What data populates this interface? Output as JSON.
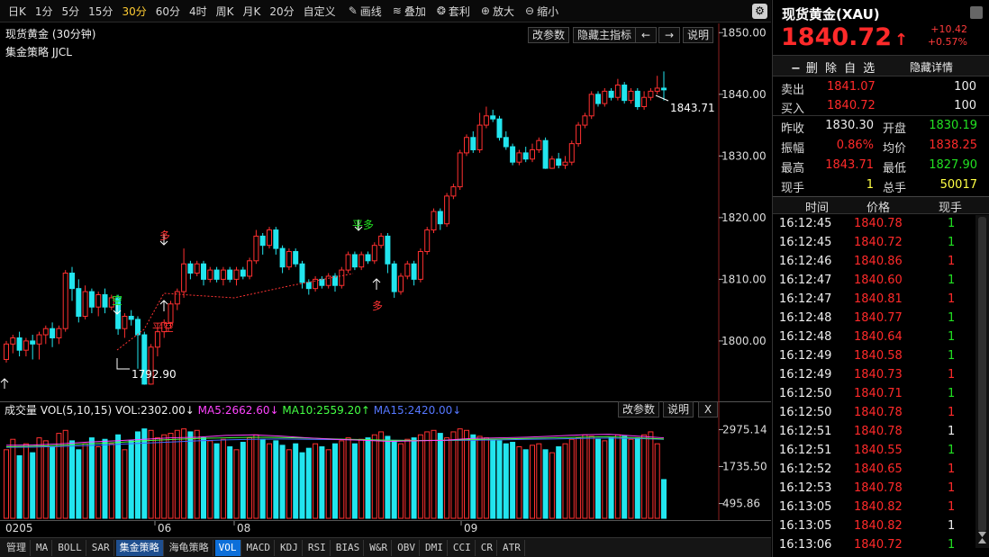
{
  "toolbar": {
    "periods": [
      "日K",
      "1分",
      "5分",
      "15分",
      "30分",
      "60分",
      "4时",
      "周K",
      "月K",
      "20分",
      "自定义"
    ],
    "active_period": "30分",
    "tools": [
      {
        "icon": "pencil-icon",
        "label": "画线"
      },
      {
        "icon": "stack-icon",
        "label": "叠加"
      },
      {
        "icon": "money-bag-icon",
        "label": "套利"
      },
      {
        "icon": "zoom-in-icon",
        "label": "放大"
      },
      {
        "icon": "zoom-out-icon",
        "label": "缩小"
      }
    ],
    "settings_icon": "gear-icon"
  },
  "chart": {
    "title": "现货黄金 (30分钟)",
    "indicator": "集金策略 JJCL",
    "buttons": {
      "edit_params": "改参数",
      "hide_indicator": "隐藏主指标",
      "prev": "←",
      "next": "→",
      "help": "说明"
    },
    "last_price_label": "1843.71",
    "low_label": "1792.90",
    "signals": [
      {
        "text": "空",
        "color": "#22e022"
      },
      {
        "text": "平空",
        "color": "#ff3333"
      },
      {
        "text": "多",
        "color": "#ff3333"
      },
      {
        "text": "平多",
        "color": "#22e022"
      },
      {
        "text": "多",
        "color": "#ff3333"
      }
    ]
  },
  "volume": {
    "title": "成交量",
    "params": "VOL(5,10,15)",
    "vol": "VOL:2302.00↓",
    "ma5": "MA5:2662.60↓",
    "ma10": "MA10:2559.20↑",
    "ma15": "MA15:2420.00↓",
    "colors": {
      "ma5": "#ff44ff",
      "ma10": "#44ff44",
      "ma15": "#4466ff"
    },
    "buttons": {
      "edit_params": "改参数",
      "help": "说明",
      "close": "X"
    },
    "yticks": [
      "2975.14",
      "1735.50",
      "495.86"
    ]
  },
  "dates": [
    "0205",
    "06",
    "08",
    "09"
  ],
  "tabs": [
    "管理",
    "MA",
    "BOLL",
    "SAR",
    "集金策略",
    "海龟策略",
    "VOL",
    "MACD",
    "KDJ",
    "RSI",
    "BIAS",
    "W&R",
    "OBV",
    "DMI",
    "CCI",
    "CR",
    "ATR"
  ],
  "quote": {
    "name": "现货黄金(XAU)",
    "price": "1840.72",
    "arrow": "↑",
    "change": "+10.42",
    "change_pct": "+0.57%",
    "remove_fav": "删 除 自 选",
    "hide_detail": "隐藏详情",
    "ask": {
      "label": "卖出",
      "price": "1841.07",
      "size": "100"
    },
    "bid": {
      "label": "买入",
      "price": "1840.72",
      "size": "100"
    },
    "stats": [
      {
        "l1": "昨收",
        "v1": "1830.30",
        "c1": "white",
        "l2": "开盘",
        "v2": "1830.19",
        "c2": "green"
      },
      {
        "l1": "振幅",
        "v1": "0.86%",
        "c1": "red",
        "l2": "均价",
        "v2": "1838.25",
        "c2": "red"
      },
      {
        "l1": "最高",
        "v1": "1843.71",
        "c1": "red",
        "l2": "最低",
        "v2": "1827.90",
        "c2": "green"
      },
      {
        "l1": "现手",
        "v1": "1",
        "c1": "yellow",
        "l2": "总手",
        "v2": "50017",
        "c2": "yellow"
      }
    ],
    "tick_headers": {
      "time": "时间",
      "price": "价格",
      "vol": "现手"
    },
    "ticks": [
      {
        "t": "16:12:45",
        "p": "1840.78",
        "v": "1",
        "c": "green"
      },
      {
        "t": "16:12:45",
        "p": "1840.72",
        "v": "1",
        "c": "green"
      },
      {
        "t": "16:12:46",
        "p": "1840.86",
        "v": "1",
        "c": "red"
      },
      {
        "t": "16:12:47",
        "p": "1840.60",
        "v": "1",
        "c": "green"
      },
      {
        "t": "16:12:47",
        "p": "1840.81",
        "v": "1",
        "c": "red"
      },
      {
        "t": "16:12:48",
        "p": "1840.77",
        "v": "1",
        "c": "green"
      },
      {
        "t": "16:12:48",
        "p": "1840.64",
        "v": "1",
        "c": "green"
      },
      {
        "t": "16:12:49",
        "p": "1840.58",
        "v": "1",
        "c": "green"
      },
      {
        "t": "16:12:49",
        "p": "1840.73",
        "v": "1",
        "c": "red"
      },
      {
        "t": "16:12:50",
        "p": "1840.71",
        "v": "1",
        "c": "green"
      },
      {
        "t": "16:12:50",
        "p": "1840.78",
        "v": "1",
        "c": "red"
      },
      {
        "t": "16:12:51",
        "p": "1840.78",
        "v": "1",
        "c": "white"
      },
      {
        "t": "16:12:51",
        "p": "1840.55",
        "v": "1",
        "c": "green"
      },
      {
        "t": "16:12:52",
        "p": "1840.65",
        "v": "1",
        "c": "red"
      },
      {
        "t": "16:12:53",
        "p": "1840.78",
        "v": "1",
        "c": "red"
      },
      {
        "t": "16:13:05",
        "p": "1840.82",
        "v": "1",
        "c": "red"
      },
      {
        "t": "16:13:05",
        "p": "1840.82",
        "v": "1",
        "c": "white"
      },
      {
        "t": "16:13:06",
        "p": "1840.72",
        "v": "1",
        "c": "green"
      }
    ]
  },
  "chart_data": {
    "type": "candlestick",
    "price_yaxis": [
      "1850.00",
      "1840.00",
      "1830.00",
      "1820.00",
      "1810.00",
      "1800.00"
    ],
    "price_ylim": [
      1790.5,
      1851.5
    ],
    "candles": [
      [
        1797.0,
        1799.5,
        1796.5,
        1800.0,
        1
      ],
      [
        1799.5,
        1800.5,
        1798.0,
        1801.0,
        1
      ],
      [
        1800.5,
        1798.5,
        1797.5,
        1801.5,
        0
      ],
      [
        1798.5,
        1800.0,
        1797.5,
        1800.5,
        1
      ],
      [
        1800.0,
        1799.5,
        1797.0,
        1801.0,
        0
      ],
      [
        1799.5,
        1801.0,
        1797.0,
        1801.5,
        1
      ],
      [
        1801.0,
        1802.0,
        1799.5,
        1802.5,
        1
      ],
      [
        1802.0,
        1800.5,
        1799.0,
        1803.0,
        0
      ],
      [
        1800.5,
        1802.0,
        1799.5,
        1802.5,
        1
      ],
      [
        1802.0,
        1811.0,
        1801.5,
        1811.5,
        1
      ],
      [
        1811.0,
        1808.5,
        1806.5,
        1812.0,
        0
      ],
      [
        1808.5,
        1804.0,
        1803.0,
        1810.0,
        0
      ],
      [
        1804.0,
        1808.0,
        1803.5,
        1809.0,
        1
      ],
      [
        1808.0,
        1805.5,
        1804.5,
        1808.5,
        0
      ],
      [
        1805.5,
        1807.5,
        1804.0,
        1808.0,
        1
      ],
      [
        1807.5,
        1805.5,
        1804.5,
        1808.5,
        0
      ],
      [
        1805.5,
        1807.0,
        1805.0,
        1807.5,
        1
      ],
      [
        1807.0,
        1802.0,
        1801.0,
        1807.5,
        0
      ],
      [
        1802.0,
        1804.0,
        1800.5,
        1804.5,
        1
      ],
      [
        1804.0,
        1803.5,
        1802.5,
        1805.0,
        0
      ],
      [
        1803.5,
        1801.0,
        1795.5,
        1804.0,
        0
      ],
      [
        1801.0,
        1793.0,
        1792.9,
        1801.5,
        0
      ],
      [
        1793.0,
        1799.0,
        1792.9,
        1799.5,
        1
      ],
      [
        1799.0,
        1801.5,
        1797.5,
        1802.0,
        1
      ],
      [
        1801.5,
        1803.0,
        1800.5,
        1803.5,
        1
      ],
      [
        1803.0,
        1806.0,
        1802.0,
        1806.5,
        1
      ],
      [
        1806.0,
        1808.0,
        1805.0,
        1808.5,
        1
      ],
      [
        1808.0,
        1812.5,
        1807.0,
        1815.0,
        1
      ],
      [
        1812.5,
        1811.0,
        1810.0,
        1813.0,
        0
      ],
      [
        1811.0,
        1812.5,
        1810.5,
        1813.0,
        1
      ],
      [
        1812.5,
        1810.0,
        1809.0,
        1813.0,
        0
      ],
      [
        1810.0,
        1811.5,
        1809.5,
        1812.0,
        1
      ],
      [
        1811.5,
        1810.0,
        1809.5,
        1812.0,
        0
      ],
      [
        1810.0,
        1811.5,
        1809.0,
        1812.0,
        1
      ],
      [
        1811.5,
        1810.0,
        1809.5,
        1812.0,
        0
      ],
      [
        1810.0,
        1811.5,
        1809.0,
        1812.0,
        1
      ],
      [
        1811.5,
        1810.5,
        1810.0,
        1812.0,
        0
      ],
      [
        1810.5,
        1813.0,
        1810.0,
        1813.5,
        1
      ],
      [
        1813.0,
        1817.0,
        1812.5,
        1818.0,
        1
      ],
      [
        1817.0,
        1815.5,
        1814.0,
        1817.5,
        0
      ],
      [
        1815.5,
        1818.0,
        1815.0,
        1818.5,
        1
      ],
      [
        1818.0,
        1815.0,
        1814.0,
        1818.5,
        0
      ],
      [
        1815.0,
        1812.0,
        1811.0,
        1815.5,
        0
      ],
      [
        1812.0,
        1814.5,
        1811.5,
        1815.0,
        1
      ],
      [
        1814.5,
        1812.5,
        1812.0,
        1815.0,
        0
      ],
      [
        1812.5,
        1809.5,
        1808.5,
        1813.0,
        0
      ],
      [
        1809.5,
        1808.5,
        1807.5,
        1810.0,
        0
      ],
      [
        1808.5,
        1810.0,
        1808.0,
        1810.5,
        1
      ],
      [
        1810.0,
        1809.0,
        1808.5,
        1810.5,
        0
      ],
      [
        1809.0,
        1810.5,
        1808.5,
        1811.0,
        1
      ],
      [
        1810.5,
        1809.0,
        1808.0,
        1811.0,
        0
      ],
      [
        1809.0,
        1811.5,
        1808.5,
        1812.0,
        1
      ],
      [
        1811.5,
        1814.0,
        1811.0,
        1814.5,
        1
      ],
      [
        1814.0,
        1812.0,
        1811.5,
        1814.5,
        0
      ],
      [
        1812.0,
        1814.0,
        1811.5,
        1814.5,
        1
      ],
      [
        1814.0,
        1813.0,
        1812.5,
        1814.5,
        0
      ],
      [
        1813.0,
        1815.5,
        1812.5,
        1816.0,
        1
      ],
      [
        1815.5,
        1817.0,
        1815.0,
        1817.5,
        1
      ],
      [
        1817.0,
        1812.5,
        1811.0,
        1817.5,
        0
      ],
      [
        1812.5,
        1808.0,
        1807.0,
        1813.0,
        0
      ],
      [
        1808.0,
        1810.5,
        1807.5,
        1811.0,
        1
      ],
      [
        1810.5,
        1812.5,
        1810.0,
        1813.0,
        1
      ],
      [
        1812.5,
        1810.0,
        1809.0,
        1813.0,
        0
      ],
      [
        1810.0,
        1814.5,
        1809.5,
        1815.0,
        1
      ],
      [
        1814.5,
        1818.0,
        1814.0,
        1818.5,
        1
      ],
      [
        1818.0,
        1821.0,
        1817.5,
        1821.5,
        1
      ],
      [
        1821.0,
        1819.0,
        1818.0,
        1821.5,
        0
      ],
      [
        1819.0,
        1823.5,
        1818.5,
        1824.0,
        1
      ],
      [
        1823.5,
        1825.0,
        1823.0,
        1825.5,
        1
      ],
      [
        1825.0,
        1830.5,
        1824.5,
        1831.0,
        1
      ],
      [
        1830.5,
        1833.0,
        1830.0,
        1833.5,
        1
      ],
      [
        1833.0,
        1831.0,
        1830.5,
        1834.0,
        0
      ],
      [
        1831.0,
        1835.0,
        1830.5,
        1837.0,
        1
      ],
      [
        1835.0,
        1836.5,
        1834.5,
        1838.0,
        1
      ],
      [
        1836.5,
        1836.0,
        1835.5,
        1837.5,
        0
      ],
      [
        1836.0,
        1833.0,
        1832.5,
        1836.5,
        0
      ],
      [
        1833.0,
        1831.5,
        1831.0,
        1834.0,
        0
      ],
      [
        1831.5,
        1829.0,
        1828.5,
        1832.0,
        0
      ],
      [
        1829.0,
        1830.5,
        1828.5,
        1831.0,
        1
      ],
      [
        1830.5,
        1829.5,
        1829.0,
        1831.5,
        0
      ],
      [
        1829.5,
        1831.0,
        1829.0,
        1832.0,
        1
      ],
      [
        1831.0,
        1832.5,
        1830.5,
        1833.0,
        1
      ],
      [
        1832.5,
        1828.0,
        1827.9,
        1833.0,
        0
      ],
      [
        1828.0,
        1829.5,
        1827.9,
        1830.0,
        1
      ],
      [
        1829.5,
        1828.5,
        1828.0,
        1830.5,
        0
      ],
      [
        1828.5,
        1829.0,
        1827.9,
        1830.0,
        1
      ],
      [
        1829.0,
        1832.0,
        1828.5,
        1832.5,
        1
      ],
      [
        1832.0,
        1835.0,
        1831.5,
        1835.5,
        1
      ],
      [
        1835.0,
        1836.5,
        1834.5,
        1837.0,
        1
      ],
      [
        1836.5,
        1840.0,
        1836.0,
        1840.5,
        1
      ],
      [
        1840.0,
        1838.5,
        1838.0,
        1840.5,
        0
      ],
      [
        1838.5,
        1840.5,
        1838.0,
        1841.0,
        1
      ],
      [
        1840.5,
        1839.5,
        1839.0,
        1841.0,
        0
      ],
      [
        1839.5,
        1841.5,
        1839.0,
        1842.5,
        1
      ],
      [
        1841.5,
        1839.0,
        1838.5,
        1842.0,
        0
      ],
      [
        1839.0,
        1840.5,
        1838.5,
        1841.0,
        1
      ],
      [
        1840.5,
        1838.0,
        1837.5,
        1841.0,
        0
      ],
      [
        1838.0,
        1839.5,
        1837.5,
        1840.5,
        1
      ],
      [
        1839.5,
        1840.5,
        1839.0,
        1841.0,
        1
      ],
      [
        1840.5,
        1841.0,
        1840.0,
        1843.0,
        1
      ],
      [
        1841.0,
        1840.72,
        1839.0,
        1843.71,
        0
      ]
    ],
    "volume_ylim": [
      0,
      3200
    ],
    "volumes": [
      2300,
      2650,
      2100,
      2500,
      2200,
      2700,
      2600,
      2400,
      2850,
      2950,
      2600,
      2300,
      2500,
      2700,
      2400,
      2650,
      2500,
      2800,
      2300,
      2600,
      2900,
      3000,
      2950,
      2700,
      2800,
      2850,
      2950,
      3000,
      2900,
      2950,
      2700,
      2600,
      2500,
      2650,
      2400,
      2300,
      2550,
      2700,
      2800,
      2650,
      2500,
      2600,
      2450,
      2300,
      2500,
      2200,
      2350,
      2500,
      2400,
      2300,
      2500,
      2600,
      2700,
      2500,
      2650,
      2700,
      2800,
      2900,
      2750,
      2600,
      2500,
      2650,
      2700,
      2800,
      2900,
      2950,
      2850,
      2700,
      2900,
      3000,
      2950,
      2800,
      2750,
      2700,
      2650,
      2600,
      2500,
      2550,
      2400,
      2300,
      2450,
      2500,
      2300,
      2200,
      2400,
      2500,
      2650,
      2700,
      2800,
      2750,
      2650,
      2600,
      2700,
      2800,
      2750,
      2650,
      2700,
      2800,
      2900,
      2500,
      1300
    ],
    "ma5_line": [
      2450,
      2460,
      2500,
      2560,
      2600,
      2650,
      2700,
      2720,
      2780,
      2800,
      2760,
      2700,
      2650,
      2620,
      2580,
      2600,
      2620,
      2680,
      2700,
      2720,
      2760,
      2800,
      2820,
      2760,
      2700
    ],
    "ma10_line": [
      2400,
      2420,
      2450,
      2500,
      2540,
      2600,
      2640,
      2680,
      2700,
      2720,
      2710,
      2690,
      2660,
      2640,
      2620,
      2610,
      2620,
      2640,
      2660,
      2680,
      2700,
      2720,
      2740,
      2700,
      2660
    ],
    "ma15_line": [
      2380,
      2390,
      2410,
      2440,
      2480,
      2520,
      2560,
      2600,
      2630,
      2650,
      2660,
      2650,
      2640,
      2630,
      2620,
      2610,
      2610,
      2620,
      2630,
      2650,
      2660,
      2680,
      2690,
      2680,
      2650
    ]
  }
}
